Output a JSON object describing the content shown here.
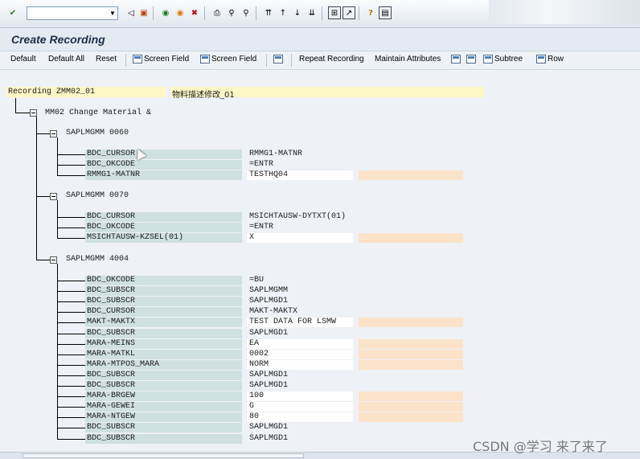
{
  "system_toolbar": {
    "command_field_value": "",
    "icons": [
      "enter-icon",
      "back-icon",
      "save-icon",
      "back-nav-icon",
      "exit-icon",
      "cancel-icon",
      "print-icon",
      "find-icon",
      "find-next-icon",
      "first-page-icon",
      "previous-page-icon",
      "next-page-icon",
      "last-page-icon",
      "create-session-icon",
      "shortcut-icon",
      "help-icon",
      "layout-icon"
    ]
  },
  "title": "Create Recording",
  "app_toolbar": {
    "default": "Default",
    "default_all": "Default All",
    "reset": "Reset",
    "screen_field_1": "Screen Field",
    "screen_field_2": "Screen Field",
    "repeat_recording": "Repeat Recording",
    "maintain_attributes": "Maintain Attributes",
    "subtree": "Subtree",
    "row": "Row"
  },
  "recording": {
    "label": "Recording ZMM02_01",
    "description": "物料描述修改_01",
    "transaction": "MM02 Change Material &",
    "screens": [
      {
        "title": "SAPLMGMM 0060",
        "fields": [
          {
            "name": "BDC_CURSOR",
            "value": "RMMG1-MATNR",
            "editable": false
          },
          {
            "name": "BDC_OKCODE",
            "value": "=ENTR",
            "editable": false
          },
          {
            "name": "RMMG1-MATNR",
            "value": "TESTHQ04",
            "editable": true
          }
        ]
      },
      {
        "title": "SAPLMGMM 0070",
        "fields": [
          {
            "name": "BDC_CURSOR",
            "value": "MSICHTAUSW-DYTXT(01)",
            "editable": false
          },
          {
            "name": "BDC_OKCODE",
            "value": "=ENTR",
            "editable": false
          },
          {
            "name": "MSICHTAUSW-KZSEL(01)",
            "value": "X",
            "editable": true
          }
        ]
      },
      {
        "title": "SAPLMGMM 4004",
        "fields": [
          {
            "name": "BDC_OKCODE",
            "value": "=BU",
            "editable": false
          },
          {
            "name": "BDC_SUBSCR",
            "value": "SAPLMGMM",
            "editable": false
          },
          {
            "name": "BDC_SUBSCR",
            "value": "SAPLMGD1",
            "editable": false
          },
          {
            "name": "BDC_CURSOR",
            "value": "MAKT-MAKTX",
            "editable": false
          },
          {
            "name": "MAKT-MAKTX",
            "value": "TEST DATA FOR LSMW",
            "editable": true
          },
          {
            "name": "BDC_SUBSCR",
            "value": "SAPLMGD1",
            "editable": false
          },
          {
            "name": "MARA-MEINS",
            "value": "EA",
            "editable": true
          },
          {
            "name": "MARA-MATKL",
            "value": "0002",
            "editable": true
          },
          {
            "name": "MARA-MTPOS_MARA",
            "value": "NORM",
            "editable": true
          },
          {
            "name": "BDC_SUBSCR",
            "value": "SAPLMGD1",
            "editable": false
          },
          {
            "name": "BDC_SUBSCR",
            "value": "SAPLMGD1",
            "editable": false
          },
          {
            "name": "MARA-BRGEW",
            "value": "100",
            "editable": true
          },
          {
            "name": "MARA-GEWEI",
            "value": "G",
            "editable": true
          },
          {
            "name": "MARA-NTGEW",
            "value": "80",
            "editable": true
          },
          {
            "name": "BDC_SUBSCR",
            "value": "SAPLMGD1",
            "editable": false
          },
          {
            "name": "BDC_SUBSCR",
            "value": "SAPLMGD1",
            "editable": false
          }
        ]
      }
    ]
  },
  "watermark": "CSDN @学习 来了来了",
  "colors": {
    "field_name_bg": "#cfe0e2",
    "recording_header_bg": "#fdf7c6",
    "editable_aux_bg": "#fbe3c9"
  }
}
